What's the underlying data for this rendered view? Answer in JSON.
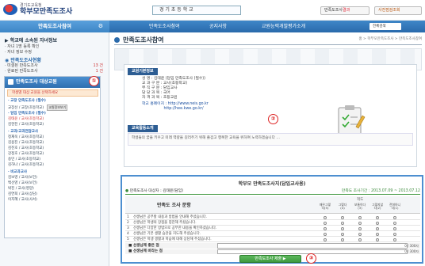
{
  "header": {
    "logo_small": "경기도교육청",
    "logo_title": "학부모만족도조사",
    "school_box": "경 기 초 등 학 교",
    "btn_result_prefix": "만족도조사",
    "btn_result_highlight": "결과",
    "btn_manual": "사전점검조회"
  },
  "nav": {
    "left": "만족도조사참여",
    "items": [
      "만족도조사참여",
      "공지사항",
      "교원능력개발평가소개"
    ],
    "select": "전체검색"
  },
  "sidebar": {
    "title1": "학교에 소속된 자녀정보",
    "link1": "· 자녀 1명 등록 확인",
    "link2": "· 자녀 정보 수정",
    "title2": "만족도조사현황",
    "rows": [
      {
        "label": "· 미결된 만족도조사",
        "value": "13 건"
      },
      {
        "label": "· 완료된 만족도조사",
        "value": "1 건"
      }
    ],
    "menu_head": "만족도조사 대상교원",
    "pill": "학생별 대상 교원을 선택하세요",
    "sections": [
      {
        "title": "· 교장 만족도조사 (필수)",
        "items": [
          "교장선 / 교장(초등학교)"
        ]
      },
      {
        "title": "· 담임 만족도조사 (필수)",
        "items": [
          "김태윤 / 교사(초등학교)",
          "김현진 / 교사(초등학교)"
        ]
      },
      {
        "title": "· 교과/교과전담교사",
        "items": [
          "정재욱 / 교사(초등학교)",
          "김용진 / 교사(초등학교)",
          "김진호 / 교사(초등학교)",
          "강정호 / 교사(초등학교)",
          "송민 / 교사(초등학교)",
          "김하나 / 교사(초등학교)"
        ]
      },
      {
        "title": "· 비교과교사",
        "items": [
          "김보영 / 교사(보건)",
          "백선영 / 교사(보건)",
          "박진 / 교사(영양)",
          "김연희 / 교사(상담)",
          "이지혜 / 교사(사서)"
        ]
      }
    ],
    "badge": "교원정보보기"
  },
  "main": {
    "title": "만족도조사참여",
    "breadcrumb": "홈 > 학부모만족도조사 > 만족도조사참여",
    "basic_label": "교원기본정보",
    "info": [
      "성    명 : 김태윤 (담임 만족도조사 (필수))",
      "교 과 구 분 : 교사(초등학교)",
      "부 직 구 분 : 담임교사",
      "담 당 과 목 : 국어",
      "자 격 과 목 : 초등교원",
      "학교 홈페이지 : http://www.neis.go.kr",
      "                  http://hee.kwe.go.kr/"
    ],
    "activity_label": "교육활동소개",
    "memo": "학생들의 꿈을 키우고 미래 역량을 길러주기 위해 즐겁고 행복한 교육을 위하여 노력하겠습니다 …"
  },
  "survey": {
    "title": "학부모 만족도조사지(담임교사용)",
    "target": "만족도조사 대상자 : 김태윤(담임)",
    "period": "만족도 조사기간 : 2013.07.09 ~ 2013.07.12",
    "q_header": "만족도 조사 문항",
    "category": "척도",
    "scale": [
      "매우그렇다(5)",
      "그렇다(4)",
      "보통이다(3)",
      "그렇지않다(2)",
      "전혀아니다(1)"
    ],
    "questions": [
      {
        "n": "1",
        "text": "선생님은 공부할 내용과 방법을 안내해 주셨습니다."
      },
      {
        "n": "2",
        "text": "선생님은 학생의 장점을 칭찬해 주셨습니다."
      },
      {
        "n": "3",
        "text": "선생님은 다양한 방법으로 공부한 내용을 확인하셨습니다."
      },
      {
        "n": "4",
        "text": "선생님은 기본 생활 습관을 지도해 주셨습니다."
      },
      {
        "n": "5",
        "text": "선생님은 학생 생활과 학습에 대해 상담해 주셨습니다."
      }
    ],
    "good_label": "■ 선생님께 좋은 점",
    "wish_label": "■ 선생님께 바라는 점",
    "count1": "0 / 300자",
    "count2": "0 / 300자",
    "submit": "만족도조사 제출 ▶"
  },
  "annotations": [
    "①",
    "②",
    "③"
  ]
}
